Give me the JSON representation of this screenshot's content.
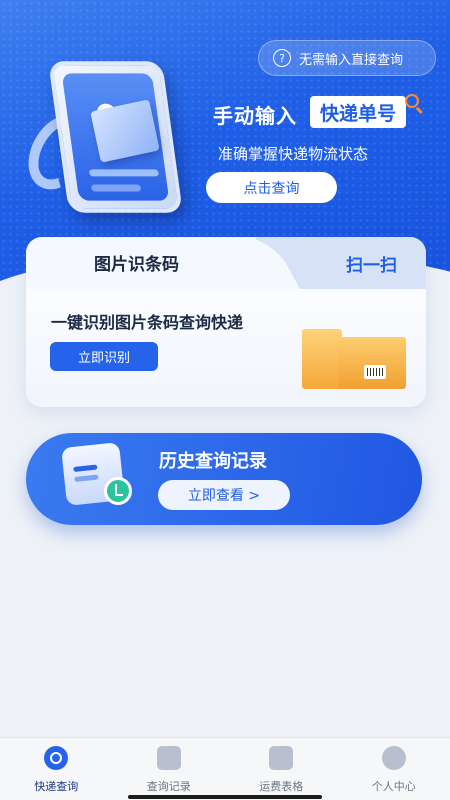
{
  "hero": {
    "help_text": "无需输入直接查询",
    "help_icon": "?",
    "title_part1": "手动输入",
    "title_part2": "快递单号",
    "subtitle": "准确掌握快递物流状态",
    "button": "点击查询"
  },
  "card": {
    "tab_active": "图片识条码",
    "tab_inactive": "扫一扫",
    "headline": "一键识别图片条码查询快递",
    "button": "立即识别"
  },
  "history": {
    "title": "历史查询记录",
    "button": "立即查看 >"
  },
  "nav": {
    "items": [
      {
        "label": "快递查询",
        "icon": "search-express-icon",
        "active": true
      },
      {
        "label": "查询记录",
        "icon": "record-icon",
        "active": false
      },
      {
        "label": "运费表格",
        "icon": "table-icon",
        "active": false
      },
      {
        "label": "个人中心",
        "icon": "user-icon",
        "active": false
      }
    ]
  },
  "colors": {
    "primary": "#1f5fe6",
    "accent": "#ff8a2a",
    "teal": "#2bc3a0"
  }
}
